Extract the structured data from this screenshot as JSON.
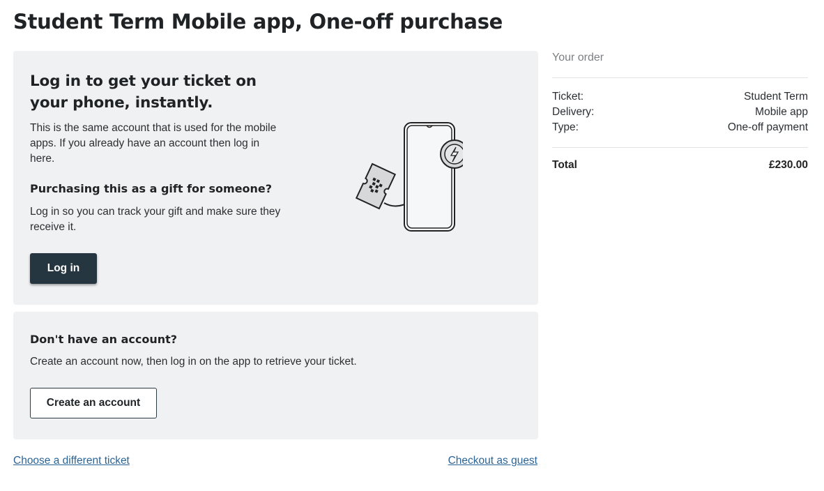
{
  "page": {
    "title": "Student Term Mobile app, One-off purchase"
  },
  "login_panel": {
    "heading": "Log in to get your ticket on your phone, instantly.",
    "description": "This is the same account that is used for the mobile apps. If you already have an account then log in here.",
    "gift_heading": "Purchasing this as a gift for someone?",
    "gift_description": "Log in so you can track your gift and make sure they receive it.",
    "login_button": "Log in",
    "illustration_icon": "phone-ticket-transfer-icon"
  },
  "account_panel": {
    "heading": "Don't have an account?",
    "description": "Create an account now, then log in on the app to retrieve your ticket.",
    "create_button": "Create an account"
  },
  "footer_links": {
    "choose_different": "Choose a different ticket",
    "checkout_guest": "Checkout as guest"
  },
  "order": {
    "title": "Your order",
    "rows": [
      {
        "label": "Ticket:",
        "value": "Student Term"
      },
      {
        "label": "Delivery:",
        "value": "Mobile app"
      },
      {
        "label": "Type:",
        "value": "One-off payment"
      }
    ],
    "total_label": "Total",
    "total_value": "£230.00"
  },
  "colors": {
    "primary_button": "#253640",
    "panel_background": "#f0f1f2",
    "link": "#2a6496"
  }
}
